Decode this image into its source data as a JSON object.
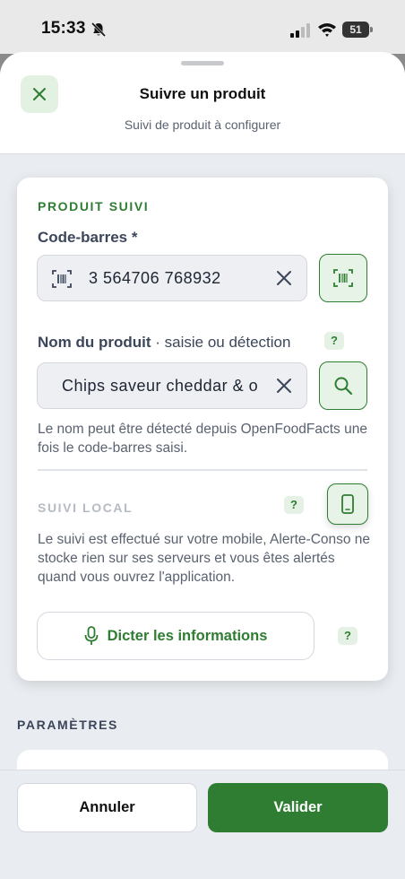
{
  "status_bar": {
    "time": "15:33",
    "battery": "51"
  },
  "header": {
    "title": "Suivre un produit",
    "subtitle": "Suivi de produit à configurer"
  },
  "product_section": {
    "title": "PRODUIT SUIVI",
    "barcode_label": "Code-barres *",
    "barcode_value": "3 564706 768932",
    "name_label": "Nom du produit",
    "name_hint": " · saisie ou détection",
    "name_value": "Chips saveur cheddar & oignon",
    "name_helper": "Le nom peut être détecté depuis OpenFoodFacts une fois le code-barres saisi.",
    "help": "?"
  },
  "local_section": {
    "title": "SUIVI LOCAL",
    "description": "Le suivi est effectué sur votre mobile, Alerte-Conso ne stocke rien sur ses serveurs et vous êtes alertés quand vous ouvrez l'application.",
    "help": "?"
  },
  "dictate": {
    "label": "Dicter les informations",
    "help": "?"
  },
  "params": {
    "title": "PARAMÈTRES"
  },
  "footer": {
    "cancel": "Annuler",
    "validate": "Valider"
  },
  "colors": {
    "accent": "#2e7d32",
    "accent_bg": "#e6f3e6"
  }
}
